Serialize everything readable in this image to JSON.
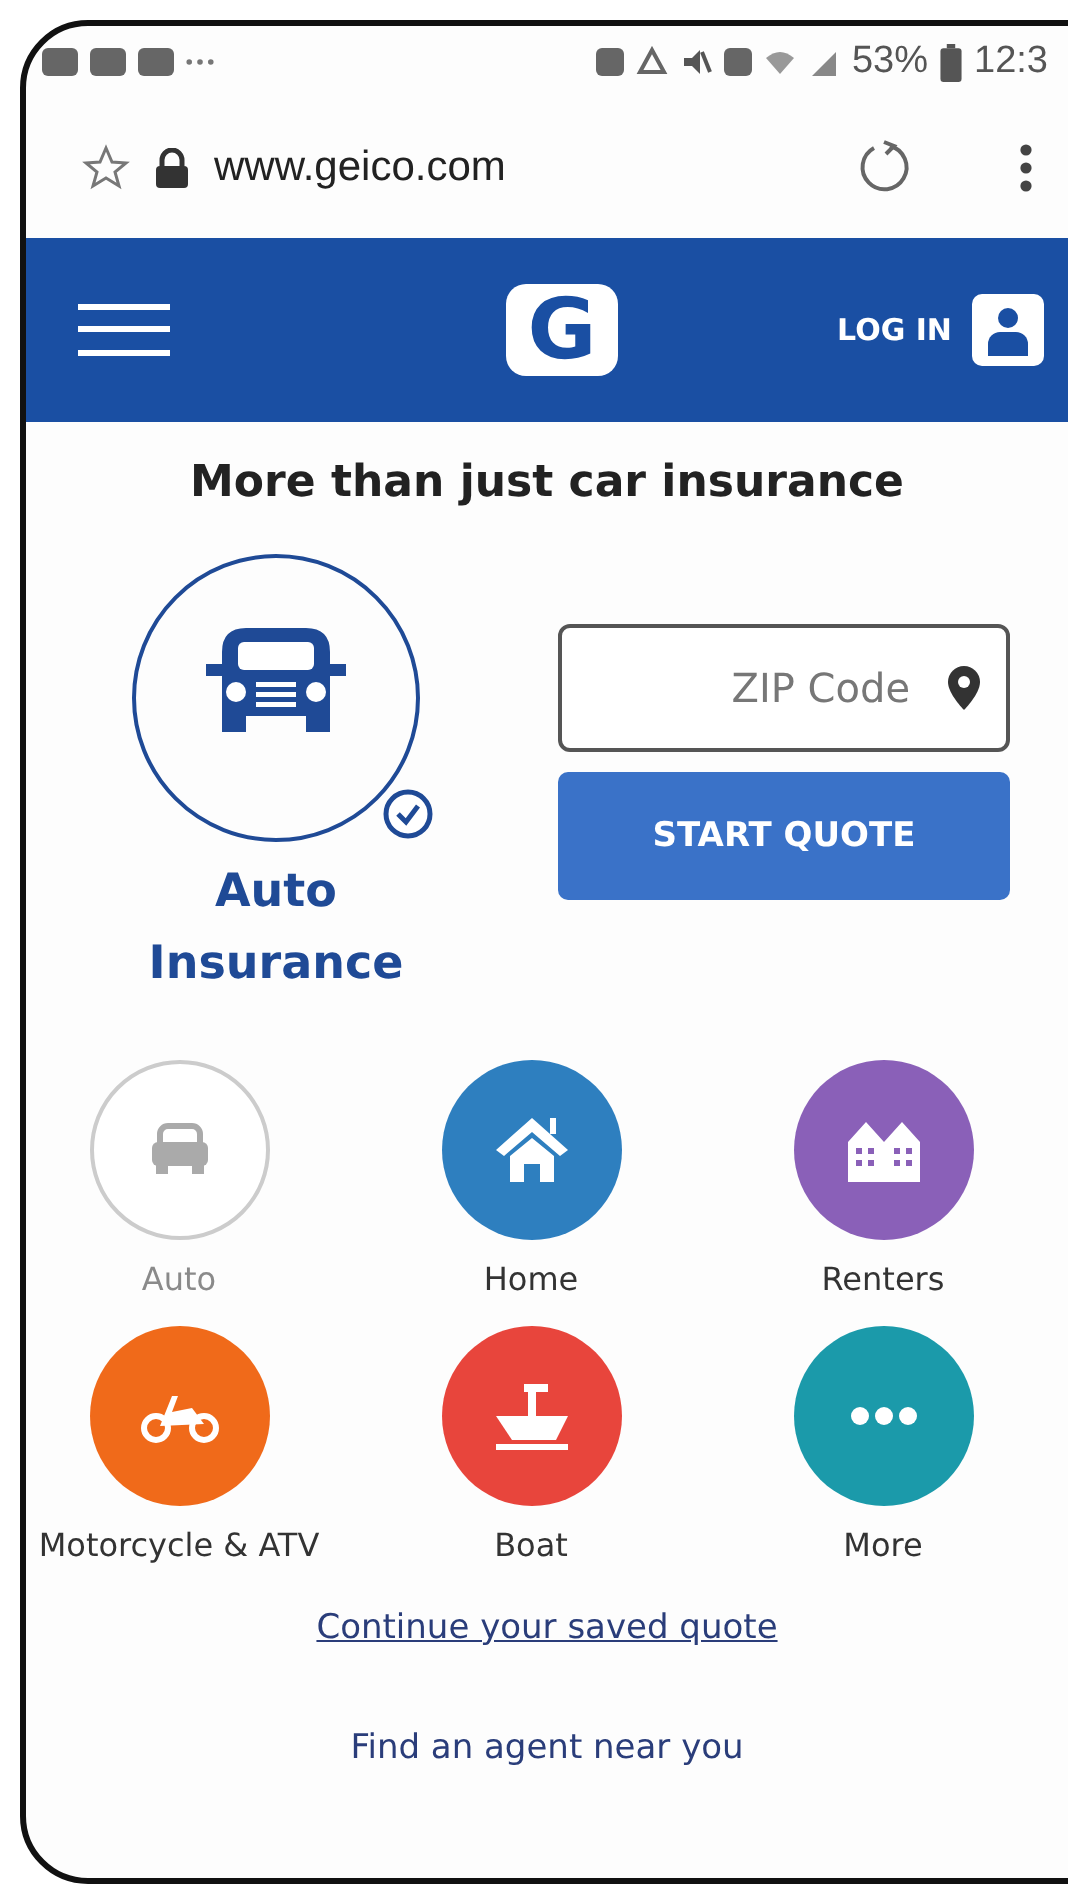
{
  "status_bar": {
    "battery": "53%",
    "time": "12:3"
  },
  "browser": {
    "url": "www.geico.com"
  },
  "header": {
    "logo": "G",
    "login": "LOG IN"
  },
  "heading": "More than just car insurance",
  "hero": {
    "product_lines": [
      "Auto",
      "Insurance"
    ],
    "zip": {
      "placeholder": "ZIP Code"
    },
    "button": "START QUOTE"
  },
  "products": [
    {
      "label": "Auto",
      "kind": "car",
      "color": "#9e9e9e",
      "selected": true
    },
    {
      "label": "Home",
      "kind": "home",
      "color": "#2e7fbf",
      "selected": false
    },
    {
      "label": "Renters",
      "kind": "renters",
      "color": "#8a60b8",
      "selected": false
    },
    {
      "label": "Motorcycle & ATV",
      "kind": "motorcycle",
      "color": "#f06a1a",
      "selected": false
    },
    {
      "label": "Boat",
      "kind": "boat",
      "color": "#e8453c",
      "selected": false
    },
    {
      "label": "More",
      "kind": "more",
      "color": "#1b9aaa",
      "selected": false
    }
  ],
  "links": [
    "Continue your saved quote",
    "Find an agent near you"
  ]
}
